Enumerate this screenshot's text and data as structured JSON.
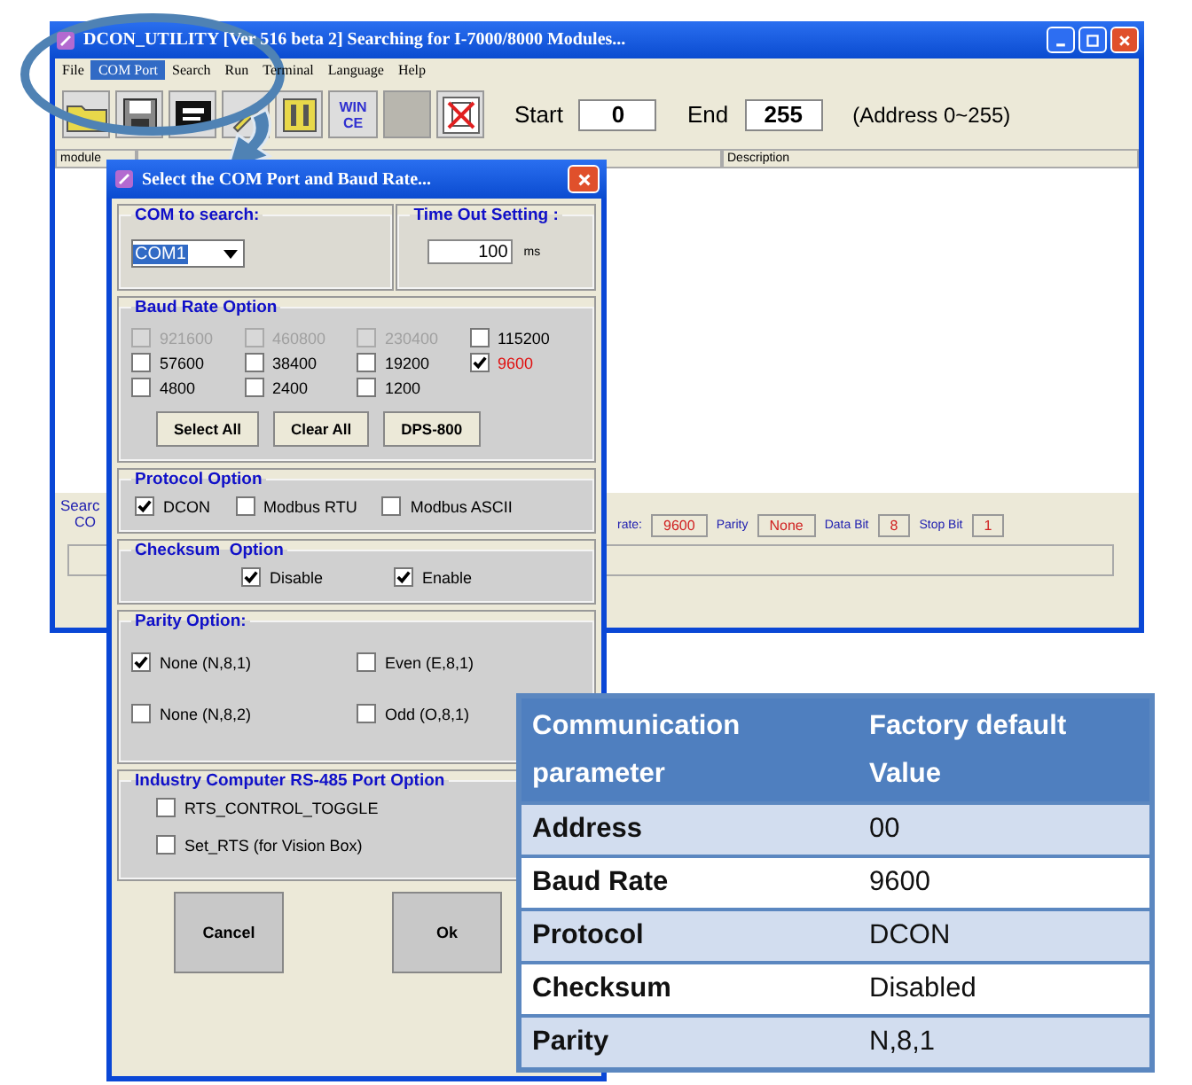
{
  "main_window": {
    "title": "DCON_UTILITY [Ver 516 beta 2] Searching for I-7000/8000 Modules...",
    "menu": [
      {
        "label": "File",
        "selected": false
      },
      {
        "label": "COM Port",
        "selected": true
      },
      {
        "label": "Search",
        "selected": false
      },
      {
        "label": "Run",
        "selected": false
      },
      {
        "label": "Terminal",
        "selected": false
      },
      {
        "label": "Language",
        "selected": false
      },
      {
        "label": "Help",
        "selected": false
      }
    ],
    "wince_label": "WIN CE",
    "start": {
      "label": "Start",
      "value": "0"
    },
    "end": {
      "label": "End",
      "value": "255"
    },
    "address_hint": "(Address 0~255)",
    "columns": [
      "module",
      "Description"
    ],
    "status": {
      "search_label": "Searc",
      "com_label": "CO",
      "fields": [
        {
          "label": "rate:",
          "value": "9600"
        },
        {
          "label": "Parity",
          "value": "None"
        },
        {
          "label": "Data Bit",
          "value": "8"
        },
        {
          "label": "Stop Bit",
          "value": "1"
        }
      ]
    }
  },
  "dialog": {
    "title": "Select the COM Port and Baud Rate...",
    "com_group": {
      "title": "COM to search:",
      "value": "COM1"
    },
    "timeout_group": {
      "title": "Time Out Setting :",
      "value": "100",
      "unit": "ms"
    },
    "baud_group": {
      "title": "Baud Rate Option",
      "options": [
        {
          "label": "921600",
          "checked": false,
          "disabled": true
        },
        {
          "label": "460800",
          "checked": false,
          "disabled": true
        },
        {
          "label": "230400",
          "checked": false,
          "disabled": true
        },
        {
          "label": "115200",
          "checked": false,
          "disabled": false
        },
        {
          "label": "57600",
          "checked": false,
          "disabled": false
        },
        {
          "label": "38400",
          "checked": false,
          "disabled": false
        },
        {
          "label": "19200",
          "checked": false,
          "disabled": false
        },
        {
          "label": "9600",
          "checked": true,
          "disabled": false
        },
        {
          "label": "4800",
          "checked": false,
          "disabled": false
        },
        {
          "label": "2400",
          "checked": false,
          "disabled": false
        },
        {
          "label": "1200",
          "checked": false,
          "disabled": false
        }
      ],
      "buttons": [
        "Select All",
        "Clear All",
        "DPS-800"
      ]
    },
    "protocol_group": {
      "title": "Protocol Option",
      "options": [
        {
          "label": "DCON",
          "checked": true
        },
        {
          "label": "Modbus RTU",
          "checked": false
        },
        {
          "label": "Modbus ASCII",
          "checked": false
        }
      ]
    },
    "checksum_group": {
      "title": "Checksum  Option",
      "options": [
        {
          "label": "Disable",
          "checked": true
        },
        {
          "label": "Enable",
          "checked": true
        }
      ]
    },
    "parity_group": {
      "title": "Parity Option:",
      "options": [
        {
          "label": "None (N,8,1)",
          "checked": true
        },
        {
          "label": "Even (E,8,1)",
          "checked": false
        },
        {
          "label": "None (N,8,2)",
          "checked": false
        },
        {
          "label": "Odd (O,8,1)",
          "checked": false
        }
      ]
    },
    "rs485_group": {
      "title": "Industry Computer RS-485 Port Option",
      "options": [
        {
          "label": "RTS_CONTROL_TOGGLE",
          "checked": false
        },
        {
          "label": "Set_RTS (for Vision Box)",
          "checked": false
        }
      ]
    },
    "buttons": [
      "Cancel",
      "Ok"
    ]
  },
  "table": {
    "columns": [
      "Communication parameter",
      "Factory default Value"
    ],
    "rows": [
      [
        "Address",
        "00"
      ],
      [
        "Baud Rate",
        "9600"
      ],
      [
        "Protocol",
        "DCON"
      ],
      [
        "Checksum",
        "Disabled"
      ],
      [
        "Parity",
        "N,8,1"
      ]
    ]
  }
}
